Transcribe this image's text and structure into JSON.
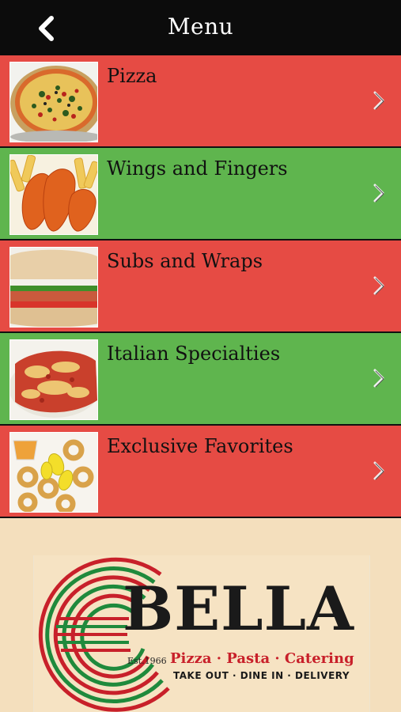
{
  "header": {
    "title": "Menu",
    "back_icon": "chevron-left-icon"
  },
  "menu_items": [
    {
      "label": "Pizza",
      "color": "#e64b44",
      "icon": "chevron-right-icon"
    },
    {
      "label": "Wings and Fingers",
      "color": "#5fb54e",
      "icon": "chevron-right-icon"
    },
    {
      "label": "Subs and Wraps",
      "color": "#e64b44",
      "icon": "chevron-right-icon"
    },
    {
      "label": "Italian Specialties",
      "color": "#5fb54e",
      "icon": "chevron-right-icon"
    },
    {
      "label": "Exclusive Favorites",
      "color": "#e64b44",
      "icon": "chevron-right-icon"
    }
  ],
  "logo": {
    "name": "BELLA",
    "established": "Est.1966",
    "tagline": "Pizza · Pasta · Catering",
    "services": "TAKE OUT · DINE IN · DELIVERY"
  },
  "colors": {
    "red_row": "#e64b44",
    "green_row": "#5fb54e",
    "header_bg": "#0c0c0c",
    "panel_bg": "#f4dfbd",
    "logo_red": "#c8202a",
    "logo_green": "#1f8a3c"
  }
}
